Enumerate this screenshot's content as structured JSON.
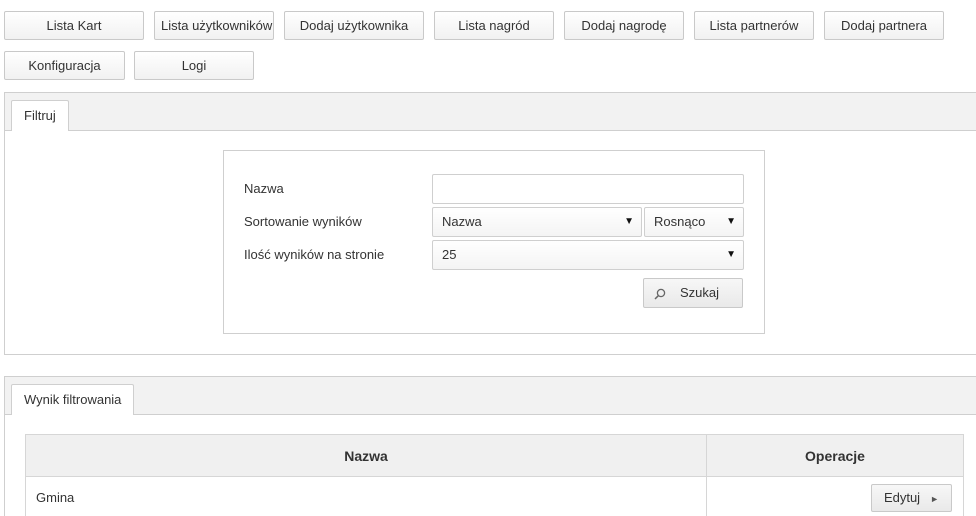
{
  "nav": {
    "lista_kart": "Lista Kart",
    "lista_uzytkownikow": "Lista użytkowników",
    "dodaj_uzytkownika": "Dodaj użytkownika",
    "lista_nagrod": "Lista nagród",
    "dodaj_nagrode": "Dodaj nagrodę",
    "lista_partnerow": "Lista partnerów",
    "dodaj_partnera": "Dodaj partnera",
    "konfiguracja": "Konfiguracja",
    "logi": "Logi"
  },
  "filter": {
    "tab_label": "Filtruj",
    "name_label": "Nazwa",
    "name_value": "",
    "sort_label": "Sortowanie wyników",
    "sort_field": "Nazwa",
    "sort_order": "Rosnąco",
    "per_page_label": "Ilość wyników na stronie",
    "per_page_value": "25",
    "search_button": "Szukaj",
    "dropdown_glyph": "▼"
  },
  "results": {
    "tab_label": "Wynik filtrowania",
    "columns": [
      "Nazwa",
      "Operacje"
    ],
    "rows": [
      {
        "name": "Gmina",
        "action": "Edytuj"
      }
    ],
    "action_glyph": "►"
  },
  "colors": {
    "border": "#cfcfcf",
    "header_bg": "#f2f2f2",
    "text": "#333333"
  },
  "icons": {
    "search": "search-icon",
    "dropdown": "chevron-down-icon",
    "edit_arrow": "chevron-right-icon"
  }
}
